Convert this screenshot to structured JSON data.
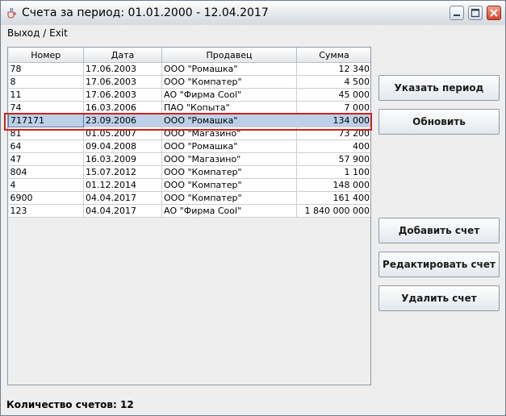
{
  "window": {
    "title": "Счета за период: 01.01.2000 - 12.04.2017",
    "minimize_icon": "minimize-icon",
    "maximize_icon": "maximize-icon",
    "close_icon": "close-icon",
    "app_icon": "java-cup-icon"
  },
  "menu": {
    "exit_label": "Выход / Exit"
  },
  "table": {
    "headers": [
      "Номер",
      "Дата",
      "Продавец",
      "Сумма"
    ],
    "rows": [
      [
        "78",
        "17.06.2003",
        "ООО \"Ромашка\"",
        "12 340"
      ],
      [
        "8",
        "17.06.2003",
        "ООО \"Компатер\"",
        "4 500"
      ],
      [
        "11",
        "17.06.2003",
        "АО \"Фирма Cool\"",
        "45 000"
      ],
      [
        "74",
        "16.03.2006",
        "ПАО \"Копыта\"",
        "7 000"
      ],
      [
        "717171",
        "23.09.2006",
        "ООО \"Ромашка\"",
        "134 000"
      ],
      [
        "81",
        "01.05.2007",
        "ООО \"Магазино\"",
        "73 200"
      ],
      [
        "64",
        "09.04.2008",
        "ООО \"Ромашка\"",
        "400"
      ],
      [
        "47",
        "16.03.2009",
        "ООО \"Магазино\"",
        "57 900"
      ],
      [
        "804",
        "15.07.2012",
        "ООО \"Компатер\"",
        "1 100"
      ],
      [
        "4",
        "01.12.2014",
        "ООО \"Компатер\"",
        "148 000"
      ],
      [
        "6900",
        "04.04.2017",
        "ООО \"Компатер\"",
        "161 400"
      ],
      [
        "123",
        "04.04.2017",
        "АО \"Фирма Cool\"",
        "1 840 000 000"
      ]
    ],
    "selected_row": 4
  },
  "buttons": {
    "set_period": "Указать период",
    "refresh": "Обновить",
    "add": "Добавить счет",
    "edit": "Редактировать счет",
    "delete": "Удалить счет"
  },
  "status": {
    "count_label": "Количество счетов: 12"
  },
  "colors": {
    "selection": "#bcd0e7",
    "highlight": "#d21f1f"
  }
}
